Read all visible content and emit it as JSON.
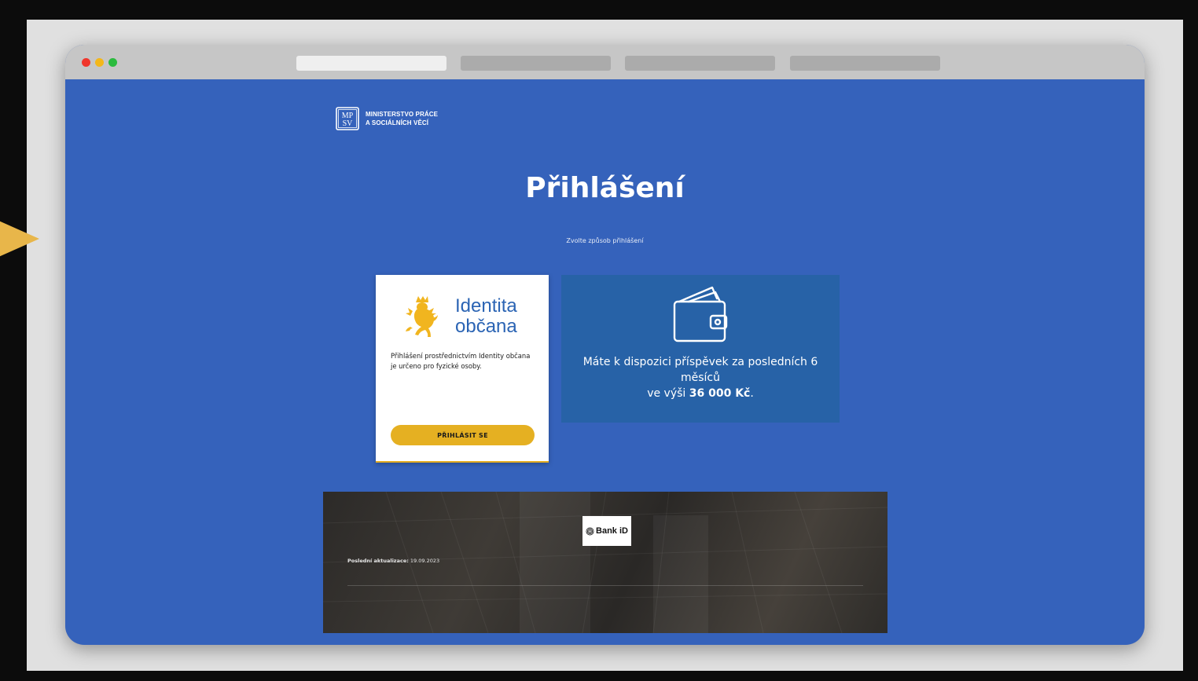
{
  "colors": {
    "page_background": "#3562bb",
    "accent": "#e5b022",
    "card_blue": "#2762a7",
    "identita_blue": "#2b64b4"
  },
  "browser": {
    "window_controls": [
      "close",
      "minimize",
      "maximize"
    ],
    "tabs": [
      {
        "active": true
      },
      {
        "active": false
      },
      {
        "active": false
      },
      {
        "active": false
      }
    ]
  },
  "header": {
    "logo_mark": "MPSV",
    "logo_line1": "MINISTERSTVO PRÁCE",
    "logo_line2": "A SOCIÁLNÍCH VĚCÍ"
  },
  "main": {
    "title": "Přihlášení",
    "subtitle": "Zvolte způsob přihlášení"
  },
  "identita_card": {
    "icon": "czech-lion-icon",
    "title_line1": "Identita",
    "title_line2": "občana",
    "description": "Přihlášení prostřednictvím Identity občana je určeno pro fyzické osoby.",
    "button_label": "PŘIHLÁSIT SE"
  },
  "wallet_card": {
    "icon": "wallet-icon",
    "text_line1": "Máte k dispozici příspěvek za posledních 6 měsíců",
    "text_line2_prefix": "ve výši ",
    "amount": "36 000 Kč",
    "text_line2_suffix": "."
  },
  "footer": {
    "bankid_label": "Bank iD",
    "last_update_label": "Poslední aktualizace:",
    "last_update_value": "19.09.2023"
  }
}
